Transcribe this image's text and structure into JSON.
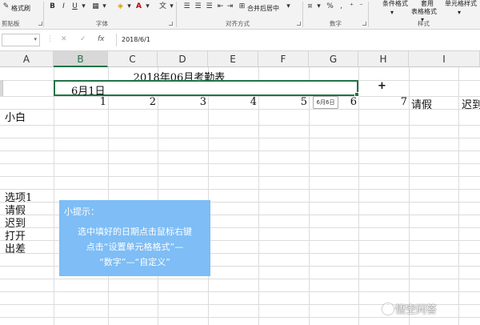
{
  "ribbon": {
    "clipboard": {
      "format_painter": "格式刷",
      "group": "剪贴板"
    },
    "font": {
      "bold": "B",
      "italic": "I",
      "underline": "U",
      "group": "字体"
    },
    "alignment": {
      "merge_center": "合并后居中",
      "group": "对齐方式"
    },
    "number": {
      "percent": "%",
      "group": "数字"
    },
    "styles": {
      "conditional": "条件格式",
      "table_format_1": "套用",
      "table_format_2": "表格格式",
      "cell_styles": "单元格样式",
      "group": "样式"
    }
  },
  "formula_bar": {
    "cancel": "✕",
    "enter": "✓",
    "fx": "fx",
    "value": "2018/6/1"
  },
  "columns": [
    "A",
    "B",
    "C",
    "D",
    "E",
    "F",
    "G",
    "H",
    "I"
  ],
  "sheet": {
    "title": "2018年06月考勤表",
    "selected_value": "6月1日",
    "days": [
      "1",
      "2",
      "3",
      "4",
      "5",
      "6",
      "7"
    ],
    "header_extra": [
      "请假",
      "迟到"
    ],
    "name": "小白",
    "legend": [
      "选项1",
      "请假",
      "迟到",
      "打开",
      "出差"
    ]
  },
  "fill_tooltip": "6月6日",
  "cursor": "+",
  "hint": {
    "title": "小提示：",
    "lines": [
      "选中填好的日期点击鼠标右键",
      "点击“设置单元格格式”—",
      "“数字”—“自定义”"
    ]
  },
  "watermark": "悟空问答",
  "colors": {
    "accent": "#217346",
    "hint_bg": "#7ebdf5"
  }
}
